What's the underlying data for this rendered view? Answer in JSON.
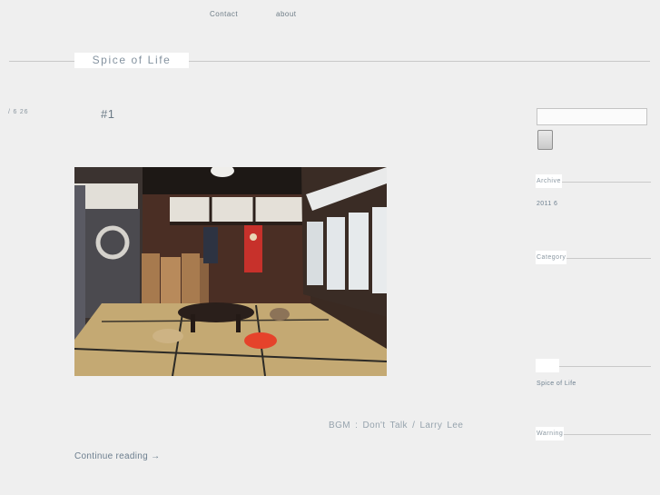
{
  "nav": {
    "contact": "Contact",
    "about": "about"
  },
  "site": {
    "title": "Spice of Life"
  },
  "post": {
    "date": "/ 6 26",
    "title": "#1",
    "bgm": "BGM : Don't Talk / Larry Lee",
    "continue_label": "Continue reading",
    "continue_arrow": "→"
  },
  "sidebar": {
    "search": {
      "value": "",
      "placeholder": ""
    },
    "archive": {
      "heading": "Archive",
      "items": [
        "2011 6"
      ]
    },
    "category": {
      "heading": "Category"
    },
    "links": {
      "heading": "",
      "items": [
        "Spice of Life"
      ]
    },
    "warning": {
      "heading": "Warning"
    }
  },
  "colors": {
    "background": "#efefef",
    "text": "#6f7f8a",
    "rule": "#c9c9c9",
    "box": "#ffffff"
  }
}
